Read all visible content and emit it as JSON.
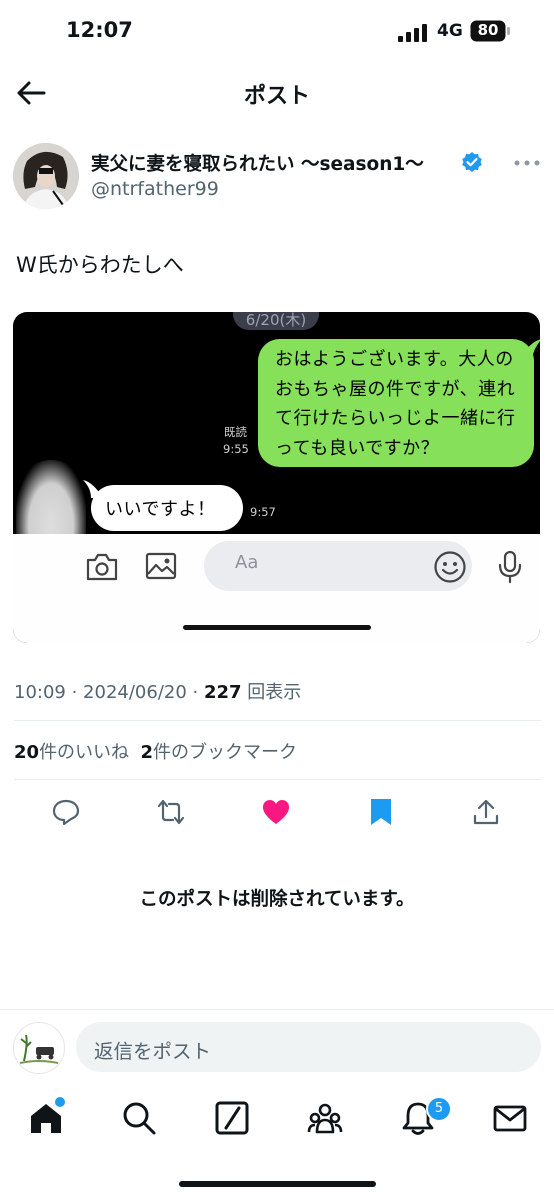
{
  "status_bar": {
    "time": "12:07",
    "network": "4G",
    "battery": "80"
  },
  "header": {
    "title": "ポスト"
  },
  "author": {
    "name": "実父に妻を寝取られたい 〜season1〜",
    "handle": "@ntrfather99"
  },
  "post": {
    "text": "W氏からわたしへ"
  },
  "media": {
    "date_label": "6/20(木)",
    "message_sent": "おはようございます。大人のおもちゃ屋の件ですが、連れて行けたらいっじよ一緒に行っても良いですか？",
    "read_label": "既読",
    "sent_time": "9:55",
    "message_received": "いいですよ！",
    "received_time": "9:57",
    "input_placeholder": "Aa"
  },
  "meta": {
    "time": "10:09",
    "date": "2024/06/20",
    "views": "227",
    "views_label": "回表示"
  },
  "stats": {
    "likes_count": "20",
    "likes_label": "件のいいね",
    "bookmarks_count": "2",
    "bookmarks_label": "件のブックマーク"
  },
  "actions": {
    "like_color": "#f91880",
    "bookmark_color": "#1d9bf0"
  },
  "deleted_notice": "このポストは削除されています。",
  "reply": {
    "placeholder": "返信をポスト"
  },
  "nav": {
    "notifications_badge": "5",
    "icons": [
      "home-icon",
      "search-icon",
      "grok-icon",
      "communities-icon",
      "bell-icon",
      "mail-icon"
    ]
  },
  "colors": {
    "accent": "#1d9bf0",
    "sent_bubble": "#86e05a",
    "text_primary": "#0f1419",
    "text_secondary": "#536471"
  }
}
